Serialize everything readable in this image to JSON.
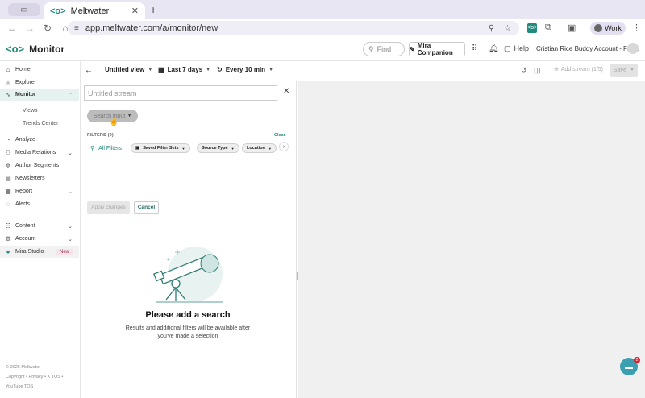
{
  "browser": {
    "tab_title": "Meltwater",
    "url": "app.meltwater.com/a/monitor/new",
    "profile": "Work"
  },
  "header": {
    "title": "Monitor",
    "find_placeholder": "Find",
    "companion_label": "Mira Companion",
    "help_label": "Help",
    "account": "Cristian Rice Buddy Account - Fair..."
  },
  "sidebar": {
    "items": [
      {
        "label": "Home",
        "icon": "home-icon"
      },
      {
        "label": "Explore",
        "icon": "compass-icon"
      },
      {
        "label": "Monitor",
        "icon": "pulse-icon"
      },
      {
        "label": "Views"
      },
      {
        "label": "Trends Center"
      },
      {
        "label": "Analyze",
        "icon": "chart-icon"
      },
      {
        "label": "Media Relations",
        "icon": "people-icon"
      },
      {
        "label": "Author Segments",
        "icon": "segments-icon"
      },
      {
        "label": "Newsletters",
        "icon": "newsletter-icon"
      },
      {
        "label": "Report",
        "icon": "report-icon"
      },
      {
        "label": "Alerts",
        "icon": "alert-icon"
      },
      {
        "label": "Content",
        "icon": "content-icon"
      },
      {
        "label": "Account",
        "icon": "gear-icon"
      },
      {
        "label": "Mira Studio",
        "icon": "mira-icon",
        "badge": "New"
      }
    ],
    "footer": {
      "copyright": "© 2026 Meltwater",
      "links": "Copyright • Privacy • X TOS •",
      "youtube": "YouTube TOS"
    }
  },
  "toolbar": {
    "view": "Untitled view",
    "range": "Last 7 days",
    "refresh": "Every 10 min",
    "add_stream": "Add stream (1/5)",
    "save": "Save"
  },
  "panel": {
    "stream_placeholder": "Untitled stream",
    "search_input": "Search input",
    "filters_label": "FILTERS (0)",
    "clear": "Clear",
    "all_filters": "All Filters",
    "chips": [
      "Saved Filter Sets",
      "Source Type",
      "Location"
    ],
    "apply": "Apply changes",
    "cancel": "Cancel",
    "empty_title": "Please add a search",
    "empty_sub": "Results and additional filters will be available after you've made a selection"
  },
  "chat_badge": "2",
  "colors": {
    "accent": "#1f8a7d",
    "sidebar_active": "#e6f2f0"
  }
}
